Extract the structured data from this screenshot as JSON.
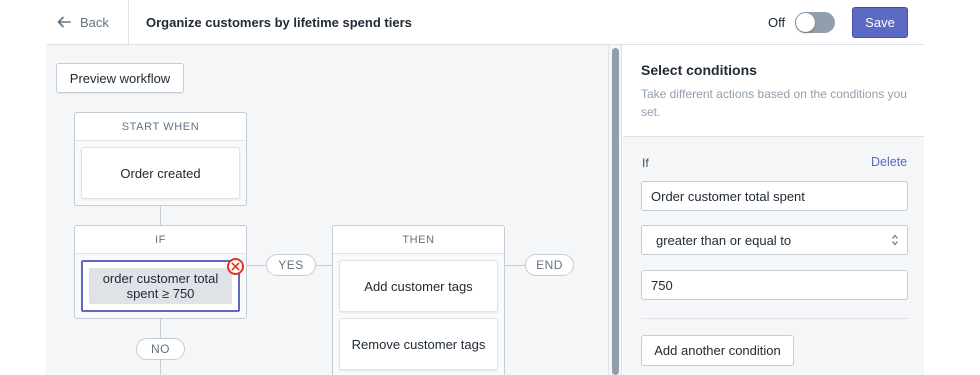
{
  "topbar": {
    "back_label": "Back",
    "workflow_title": "Organize customers by lifetime spend tiers",
    "toggle_label": "Off",
    "toggle_state": "off",
    "save_label": "Save"
  },
  "canvas": {
    "preview_label": "Preview workflow",
    "start_card": {
      "header": "START WHEN",
      "trigger": "Order created"
    },
    "if_card": {
      "header": "IF",
      "condition_line1": "order customer total",
      "condition_line2": "spent ≥ 750"
    },
    "then_card": {
      "header": "THEN",
      "actions": [
        "Add customer tags",
        "Remove customer tags"
      ]
    },
    "connectors": {
      "yes": "YES",
      "no": "NO",
      "end": "END"
    }
  },
  "panel": {
    "title": "Select conditions",
    "description": "Take different actions based on the conditions you set.",
    "if_label": "If",
    "delete_label": "Delete",
    "condition_field": "Order customer total spent",
    "operator_select": "greater than or equal to",
    "value_field": "750",
    "add_condition_label": "Add another condition"
  },
  "colors": {
    "primary": "#5c6ac4",
    "danger": "#de3618",
    "canvas_bg": "#f4f6f8",
    "border": "#c4cdd5"
  }
}
